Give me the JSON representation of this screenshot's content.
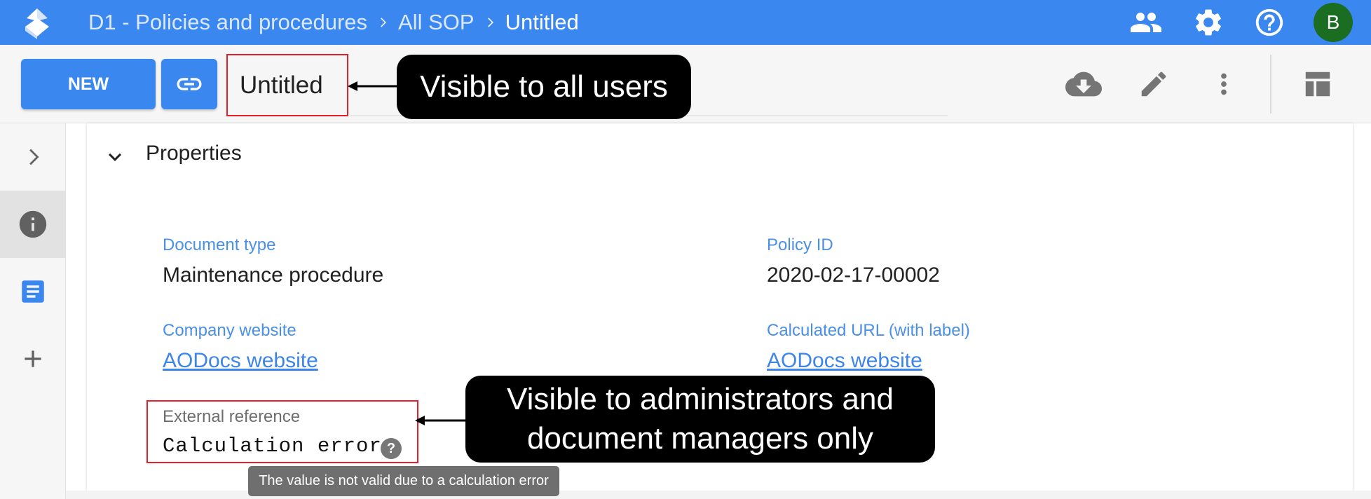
{
  "header": {
    "breadcrumbs": [
      "D1 - Policies and procedures",
      "All SOP",
      "Untitled"
    ],
    "avatar_initial": "B",
    "icons": [
      "people-icon",
      "settings-gear-icon",
      "help-circle-icon"
    ]
  },
  "toolbar": {
    "new_label": "NEW",
    "document_title": "Untitled",
    "icons": [
      "link-icon",
      "cloud-download-icon",
      "edit-pencil-icon",
      "more-vert-icon",
      "layout-icon"
    ]
  },
  "rail": {
    "icons": [
      "chevron-right-icon",
      "info-icon",
      "document-icon",
      "add-icon"
    ]
  },
  "properties": {
    "section_title": "Properties",
    "fields": [
      {
        "label": "Document type",
        "value": "Maintenance procedure"
      },
      {
        "label": "Policy ID",
        "value": "2020-02-17-00002"
      },
      {
        "label": "Company website",
        "value": "AODocs website"
      },
      {
        "label": "Calculated URL (with label)",
        "value": "AODocs website"
      }
    ],
    "external_reference": {
      "label": "External reference",
      "value": "Calculation error",
      "tooltip": "The value is not valid due to a calculation error"
    }
  },
  "callouts": {
    "title_note": "Visible to all users",
    "field_note_line1": "Visible to administrators and",
    "field_note_line2": "document managers only"
  },
  "colors": {
    "brand_blue": "#3b87f0",
    "highlight_red": "#e4202a",
    "label_blue": "#4a8fe8",
    "avatar_green": "#1b6d22"
  }
}
